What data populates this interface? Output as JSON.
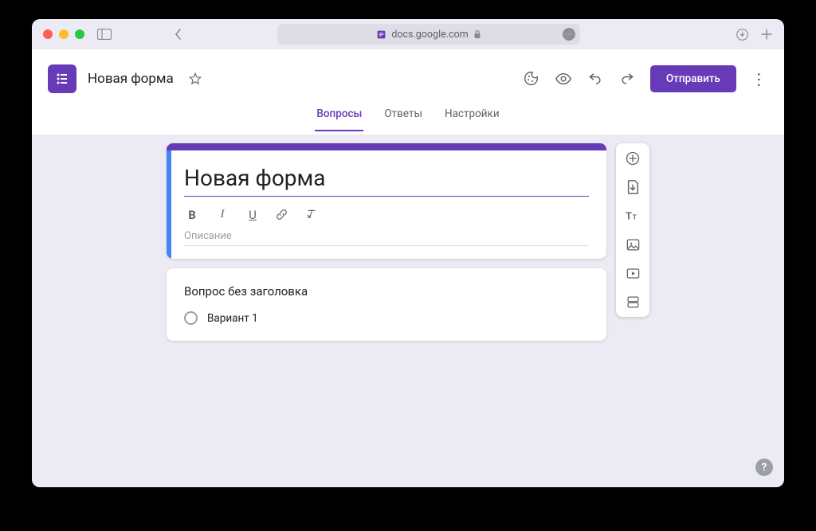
{
  "browser": {
    "url": "docs.google.com"
  },
  "header": {
    "doc_title": "Новая форма",
    "send_button": "Отправить"
  },
  "tabs": {
    "questions": "Вопросы",
    "answers": "Ответы",
    "settings": "Настройки"
  },
  "form": {
    "title": "Новая форма",
    "description_placeholder": "Описание",
    "question": {
      "title": "Вопрос без заголовка",
      "option1": "Вариант 1"
    }
  }
}
